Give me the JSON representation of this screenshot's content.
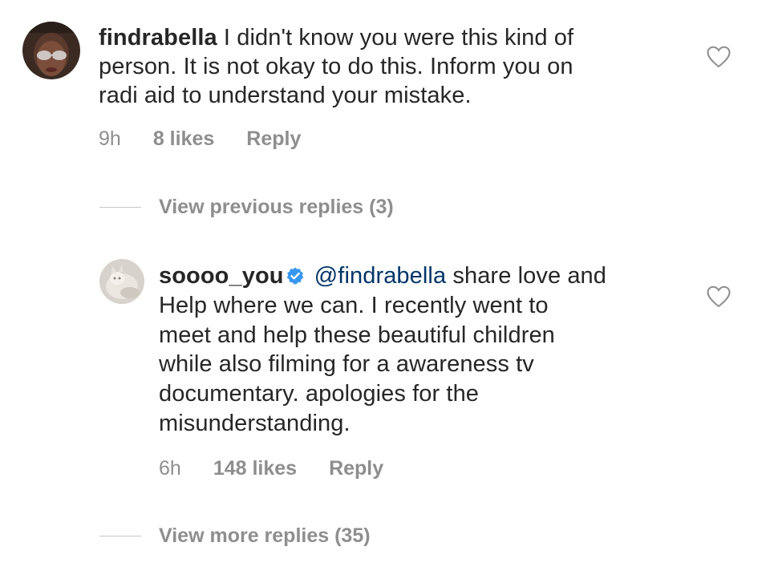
{
  "comments": [
    {
      "username": "findrabella",
      "text": "I didn't know you were this kind of person. It is not okay to do this. Inform you on radi aid to understand your mistake.",
      "text_lines": [
        "I didn't know you were this kind of",
        "person. It is not okay to do this. Inform you on",
        "radi aid to understand your mistake."
      ],
      "time": "9h",
      "likes": "8 likes",
      "reply_label": "Reply",
      "verified": false,
      "avatar_icon": "profile-photo-woman-glasses"
    },
    {
      "username": "soooo_you",
      "verified": true,
      "mention": "@findrabella",
      "text_lines": [
        "share love and",
        "Help where we can. I recently went to",
        "meet and help these beautiful children",
        "while also filming for a awareness tv",
        "documentary. apologies for the",
        "misunderstanding."
      ],
      "time": "6h",
      "likes": "148 likes",
      "reply_label": "Reply",
      "avatar_icon": "profile-photo-cat"
    }
  ],
  "threads": {
    "previous_replies": "View previous replies (3)",
    "more_replies": "View more replies (35)"
  },
  "icons": {
    "like": "heart-outline-icon",
    "verified": "verified-badge-icon"
  },
  "colors": {
    "text": "#262626",
    "secondary": "#8e8e8e",
    "mention": "#003569",
    "verified": "#3897f0",
    "divider": "#c7c7c7"
  }
}
